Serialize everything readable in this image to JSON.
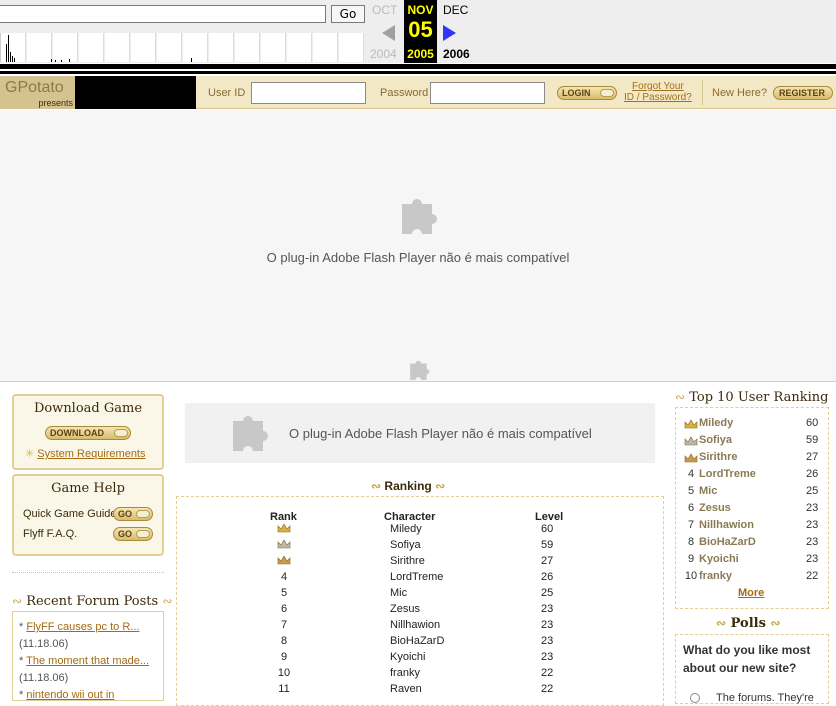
{
  "wayback": {
    "go_label": "Go",
    "prev_month": "OCT",
    "cur_month": "NOV",
    "next_month": "DEC",
    "cur_day": "05",
    "prev_year": "2004",
    "cur_year": "2005",
    "next_year": "2006"
  },
  "site": {
    "logo": "GPotato",
    "logo_sub": "presents"
  },
  "login": {
    "user_id_label": "User ID",
    "password_label": "Password",
    "login_button": "LOGIN",
    "forgot_line1": "Forgot Your",
    "forgot_line2": "ID / Password?",
    "new_here": "New Here?",
    "register_button": "REGISTER"
  },
  "flash": {
    "message": "O plug-in Adobe Flash Player não é mais compatível"
  },
  "left": {
    "download_title": "Download Game",
    "download_button": "DOWNLOAD",
    "system_req": "System Requirements",
    "help_title": "Game Help",
    "quick_guide": "Quick Game Guide",
    "faq": "Flyff F.A.Q.",
    "go": "GO",
    "forum_title": "Recent Forum Posts",
    "forum_posts": [
      {
        "title": "FlyFF causes pc to R...",
        "date": "(11.18.06)"
      },
      {
        "title": "The moment that made...",
        "date": "(11.18.06)"
      },
      {
        "title": "nintendo wii  out in",
        "date": ""
      }
    ]
  },
  "ranking": {
    "title": "Ranking",
    "headers": {
      "rank": "Rank",
      "character": "Character",
      "level": "Level"
    },
    "rows": [
      {
        "rank": "",
        "character": "Miledy",
        "level": "60",
        "crown": "gold-crown-icon"
      },
      {
        "rank": "",
        "character": "Sofiya",
        "level": "59",
        "crown": "silver-crown-icon"
      },
      {
        "rank": "",
        "character": "Sirithre",
        "level": "27",
        "crown": "bronze-crown-icon"
      },
      {
        "rank": "4",
        "character": "LordTreme",
        "level": "26"
      },
      {
        "rank": "5",
        "character": "Mic",
        "level": "25"
      },
      {
        "rank": "6",
        "character": "Zesus",
        "level": "23"
      },
      {
        "rank": "7",
        "character": "Nillhawion",
        "level": "23"
      },
      {
        "rank": "8",
        "character": "BioHaZarD",
        "level": "23"
      },
      {
        "rank": "9",
        "character": "Kyoichi",
        "level": "23"
      },
      {
        "rank": "10",
        "character": "franky",
        "level": "22"
      },
      {
        "rank": "11",
        "character": "Raven",
        "level": "22"
      }
    ]
  },
  "top10": {
    "title": "Top 10 User Ranking",
    "rows": [
      {
        "rank": "",
        "name": "Miledy",
        "level": "60",
        "crown": "gold-crown-icon"
      },
      {
        "rank": "",
        "name": "Sofiya",
        "level": "59",
        "crown": "silver-crown-icon"
      },
      {
        "rank": "",
        "name": "Sirithre",
        "level": "27",
        "crown": "bronze-crown-icon"
      },
      {
        "rank": "4",
        "name": "LordTreme",
        "level": "26"
      },
      {
        "rank": "5",
        "name": "Mic",
        "level": "25"
      },
      {
        "rank": "6",
        "name": "Zesus",
        "level": "23"
      },
      {
        "rank": "7",
        "name": "Nillhawion",
        "level": "23"
      },
      {
        "rank": "8",
        "name": "BioHaZarD",
        "level": "23"
      },
      {
        "rank": "9",
        "name": "Kyoichi",
        "level": "23"
      },
      {
        "rank": "10",
        "name": "franky",
        "level": "22"
      }
    ],
    "more": "More"
  },
  "polls": {
    "title": "Polls",
    "question": "What do you like most about our new site?",
    "option1": "The forums. They're"
  }
}
